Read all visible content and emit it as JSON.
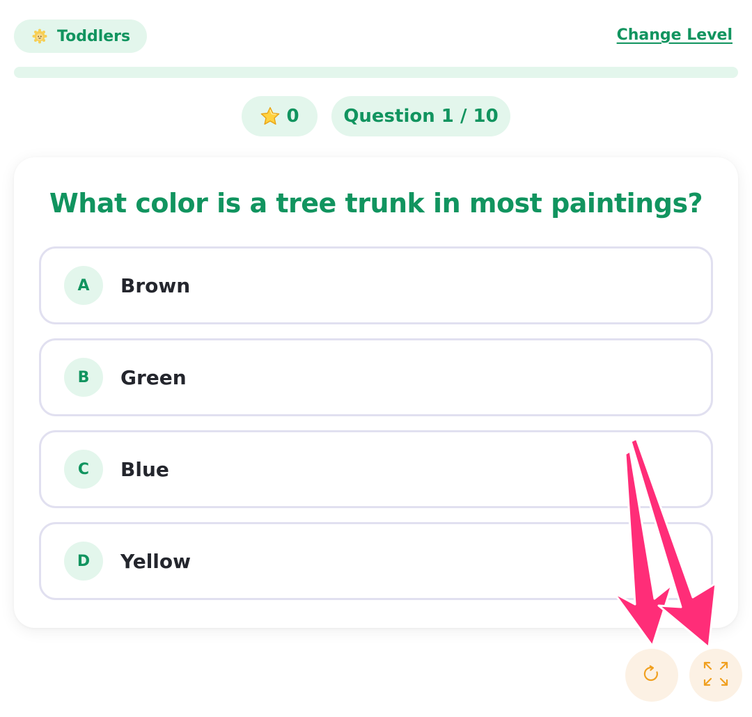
{
  "header": {
    "level_label": "Toddlers",
    "level_icon": "baby-face-icon",
    "change_level_label": "Change Level"
  },
  "progress": {
    "fraction": 0.0
  },
  "stats": {
    "star_icon": "star-icon",
    "score": "0",
    "question_counter": "Question 1 / 10"
  },
  "quiz": {
    "question": "What color is a tree trunk in most paintings?",
    "options": [
      {
        "letter": "A",
        "text": "Brown"
      },
      {
        "letter": "B",
        "text": "Green"
      },
      {
        "letter": "C",
        "text": "Blue"
      },
      {
        "letter": "D",
        "text": "Yellow"
      }
    ]
  },
  "controls": {
    "restart_icon": "restart-icon",
    "fullscreen_icon": "fullscreen-icon"
  },
  "colors": {
    "accent_green": "#11945f",
    "pill_bg": "#e3f6ec",
    "option_border": "#e1e0f0",
    "control_bg": "#fcf1e4",
    "control_icon": "#f0a020",
    "annotation_arrow": "#ff2d78"
  }
}
